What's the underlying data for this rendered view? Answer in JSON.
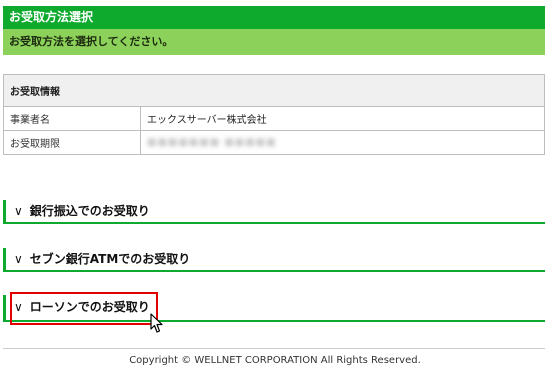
{
  "header": {
    "title": "お受取方法選択",
    "subtitle": "お受取方法を選択してください。"
  },
  "info": {
    "heading": "お受取情報",
    "rows": [
      {
        "label": "事業者名",
        "value": "エックスサーバー株式会社"
      },
      {
        "label": "お受取期限",
        "value": ""
      }
    ]
  },
  "sections": [
    {
      "chevron": "∨",
      "label": "銀行振込でのお受取り"
    },
    {
      "chevron": "∨",
      "label": "セブン銀行ATMでのお受取り"
    },
    {
      "chevron": "∨",
      "label": "ローソンでのお受取り"
    }
  ],
  "footer": {
    "copyright": "Copyright © WELLNET CORPORATION All Rights Reserved."
  },
  "colors": {
    "header_green": "#0daa2d",
    "subheader_green": "#8cd15a",
    "highlight_red": "#e00000"
  }
}
